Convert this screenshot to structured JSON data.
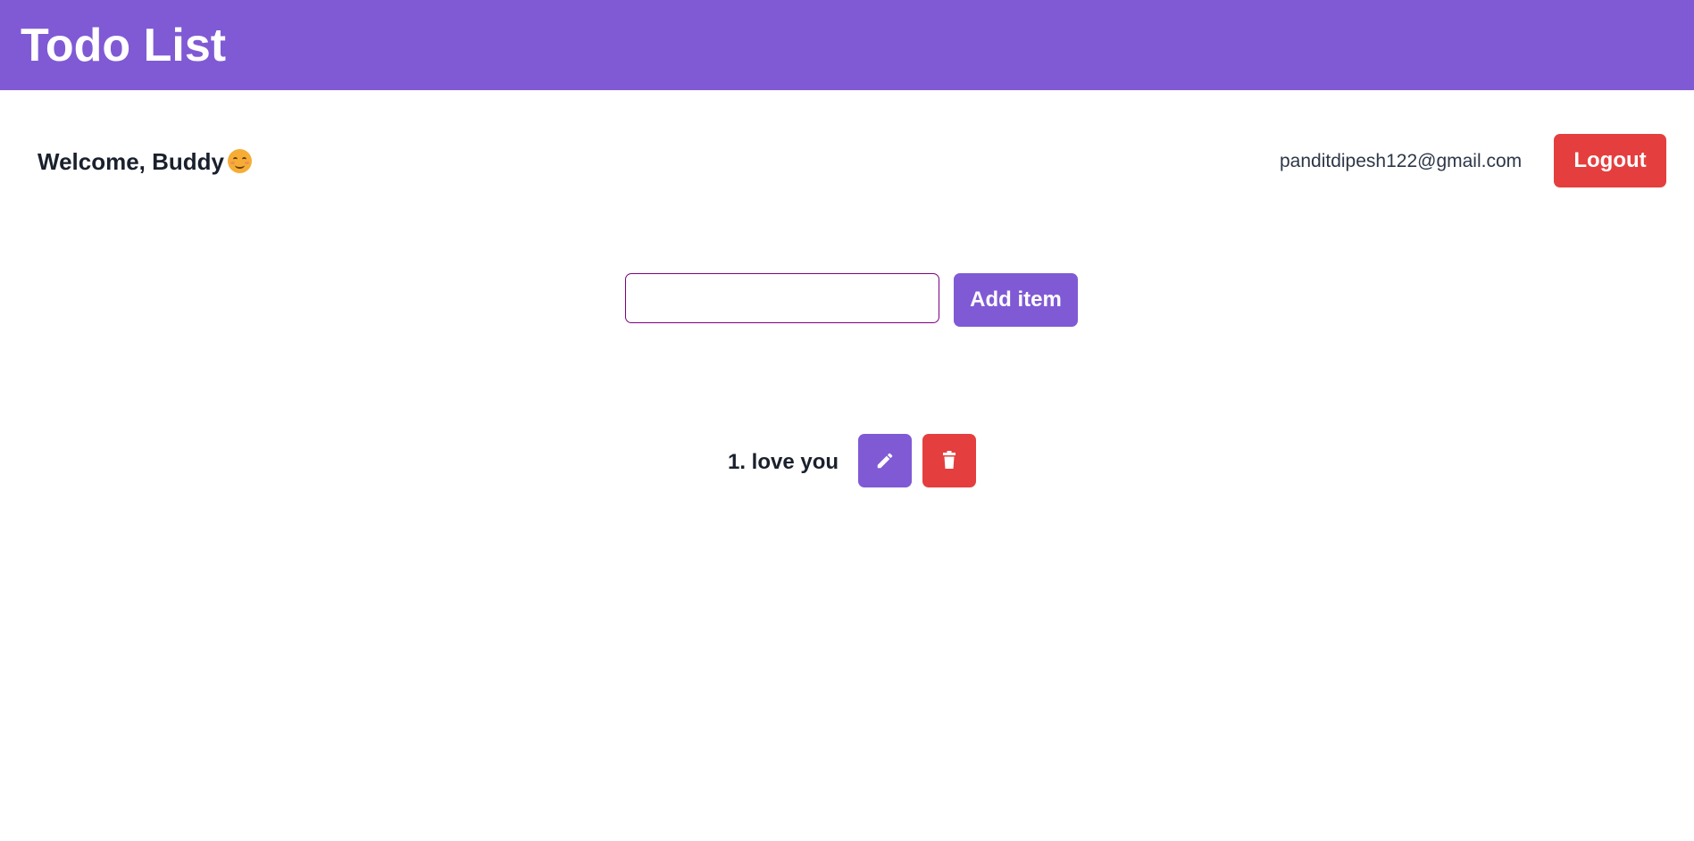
{
  "header": {
    "title": "Todo List",
    "background": "#805ad5"
  },
  "user": {
    "welcome_text": "Welcome, Buddy",
    "emoji_icon": "smiling-face-icon",
    "email": "panditdipesh122@gmail.com",
    "logout_label": "Logout"
  },
  "composer": {
    "input_value": "",
    "input_placeholder": "",
    "add_label": "Add item"
  },
  "todos": [
    {
      "text": "1. love you",
      "edit_icon": "pencil-icon",
      "delete_icon": "trash-icon"
    }
  ],
  "colors": {
    "accent": "#805ad5",
    "danger": "#e53e3e",
    "input_border": "#800080"
  }
}
